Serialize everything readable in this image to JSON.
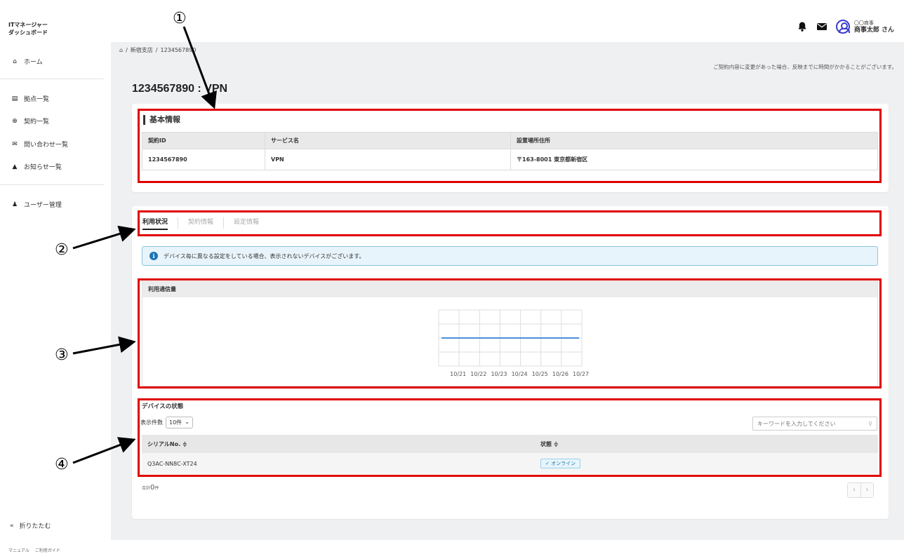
{
  "app": {
    "title_line1": "ITマネージャー",
    "title_line2": "ダッシュボード"
  },
  "header": {
    "user_role": "〇〇商事",
    "user_name": "商事太郎 さん"
  },
  "sidebar": {
    "items": [
      {
        "label": "ホーム",
        "icon": "home-icon"
      },
      {
        "label": "拠点一覧",
        "icon": "building-icon"
      },
      {
        "label": "契約一覧",
        "icon": "globe-icon"
      },
      {
        "label": "問い合わせ一覧",
        "icon": "mail-icon"
      },
      {
        "label": "お知らせ一覧",
        "icon": "bell-icon"
      },
      {
        "label": "ユーザー管理",
        "icon": "user-icon"
      }
    ],
    "collapse_label": "折りたたむ",
    "footer": [
      "マニュアル",
      "ご利用ガイド"
    ]
  },
  "breadcrumb": {
    "items": [
      "新宿支店",
      "1234567890"
    ]
  },
  "notice_top": "ご契約内容に変更があった場合、反映までに時間がかかることがございます。",
  "page_title": "1234567890 : VPN",
  "basic_info": {
    "title": "基本情報",
    "headers": [
      "契約ID",
      "サービス名",
      "設置場所住所"
    ],
    "row": [
      "1234567890",
      "VPN",
      "〒163-8001 東京都新宿区"
    ]
  },
  "tabs": [
    "利用状況",
    "契約情報",
    "設定情報"
  ],
  "alert_text": "デバイス毎に異なる設定をしている場合、表示されないデバイスがございます。",
  "usage": {
    "title": "利用通信量"
  },
  "chart_data": {
    "type": "line",
    "categories": [
      "10/21",
      "10/22",
      "10/23",
      "10/24",
      "10/25",
      "10/26",
      "10/27"
    ],
    "series": [
      {
        "values": [
          0,
          0,
          0,
          0,
          0,
          0,
          0
        ],
        "color": "#4a90d9"
      }
    ],
    "grid": true
  },
  "devices": {
    "title": "デバイスの状態",
    "per_page_label": "表示件数",
    "per_page_value": "10件",
    "search_placeholder": "キーワードを入力してください",
    "headers": [
      "シリアルNo. ≑",
      "状態 ≑"
    ],
    "rows": [
      {
        "serial": "Q3AC-NN8C-XT24",
        "status": "✓ オンライン"
      }
    ],
    "total_prefix": "合計",
    "total_count": "0",
    "total_suffix": "件"
  },
  "annotations": [
    "①",
    "②",
    "③",
    "④"
  ],
  "colors": {
    "annotation_red": "#e00000",
    "accent_blue": "#1d73b5"
  }
}
